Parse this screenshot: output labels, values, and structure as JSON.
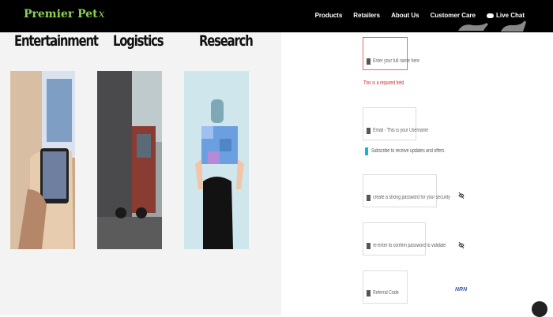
{
  "brand": {
    "name": "Premier Pet",
    "suffix": "x"
  },
  "nav": {
    "items": [
      "Products",
      "Retailers",
      "About Us",
      "Customer Care"
    ],
    "live_chat": "Live Chat"
  },
  "categories": [
    {
      "title": "Entertainment",
      "image": "person-using-tablet"
    },
    {
      "title": "Logistics",
      "image": "truck-at-dock"
    },
    {
      "title": "Research",
      "image": "woman-holding-cube"
    }
  ],
  "form": {
    "name_field": {
      "placeholder": "Enter your full name here",
      "state": "error"
    },
    "error_message": "This is a required field",
    "email_field": {
      "placeholder": "Email - This is your Username"
    },
    "subscribe_label": "Subscribe to receive updates and offers",
    "password_field": {
      "placeholder": "create a strong password for your security"
    },
    "confirm_password_field": {
      "placeholder": "re-enter to confirm password to validate"
    },
    "referral_field": {
      "placeholder": "Referral Code"
    },
    "captcha_label": "NRN"
  },
  "colors": {
    "brand_green": "#8fd14f",
    "nav_bg": "#000000",
    "error_red": "#d03030",
    "checkbox_cyan": "#17b6d0"
  },
  "icons": [
    "paw-icon",
    "chat-icon",
    "eye-icon",
    "lock-icon",
    "user-icon",
    "email-icon"
  ]
}
